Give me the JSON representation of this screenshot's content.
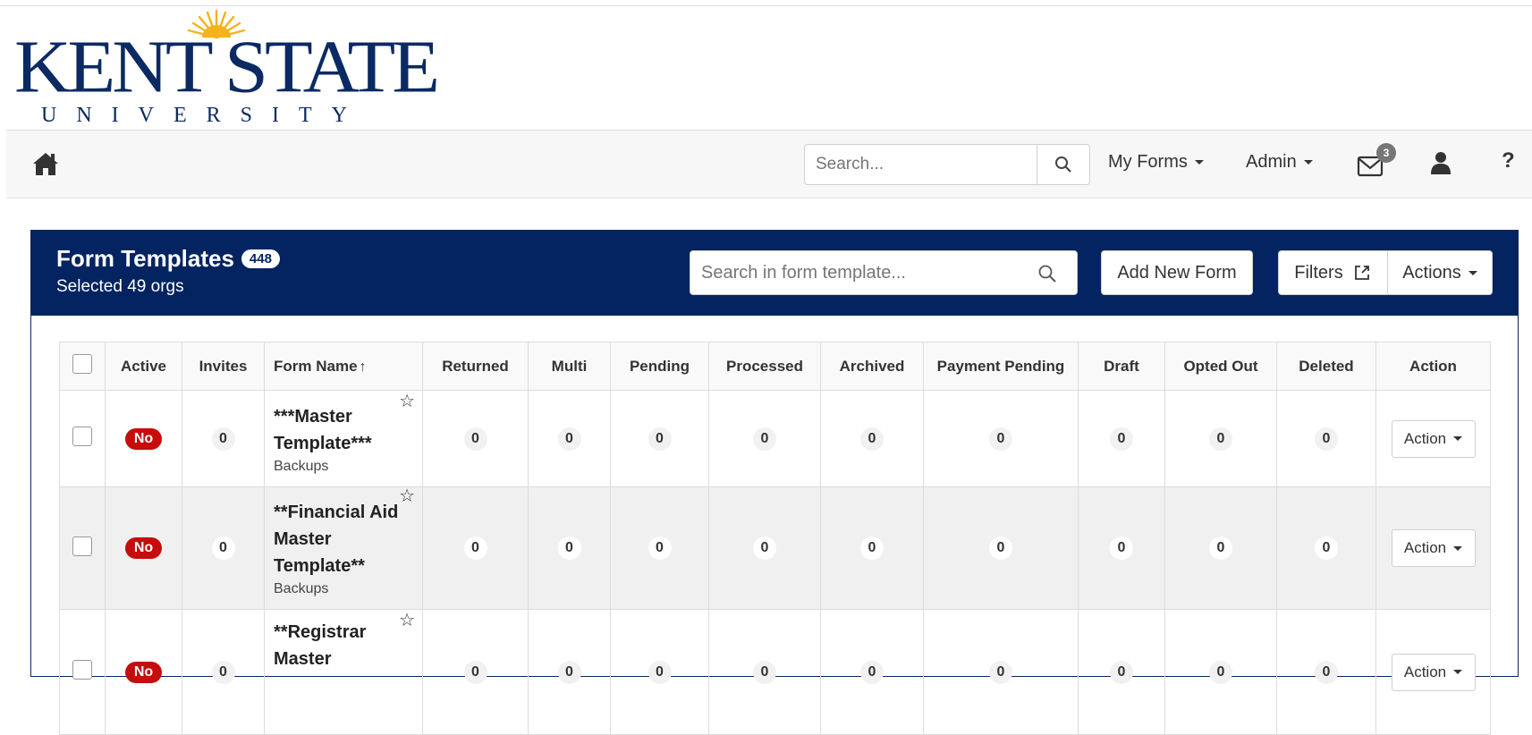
{
  "brand": {
    "name": "KENT STATE",
    "sub": "UNIVERSITY",
    "color": "#0b2a63",
    "accent": "#f5b21b"
  },
  "navbar": {
    "search_placeholder": "Search...",
    "my_forms": "My Forms",
    "admin": "Admin",
    "mail_count": "3",
    "help": "?",
    "icons": [
      "home-icon",
      "search-icon",
      "mail-icon",
      "user-icon"
    ]
  },
  "panel": {
    "title": "Form Templates",
    "count": "448",
    "subtitle": "Selected 49 orgs",
    "search_placeholder": "Search in form template...",
    "add_new": "Add New Form",
    "filters": "Filters",
    "actions": "Actions",
    "header_color": "#032461"
  },
  "table": {
    "columns": [
      "Active",
      "Invites",
      "Form Name",
      "Returned",
      "Multi",
      "Pending",
      "Processed",
      "Archived",
      "Payment Pending",
      "Draft",
      "Opted Out",
      "Deleted",
      "Action"
    ],
    "sort_indicator": "↑",
    "rows": [
      {
        "active": "No",
        "invites": "0",
        "name": "***Master Template***",
        "category": "Backups",
        "returned": "0",
        "multi": "0",
        "pending": "0",
        "processed": "0",
        "archived": "0",
        "payment_pending": "0",
        "draft": "0",
        "opted_out": "0",
        "deleted": "0",
        "action": "Action"
      },
      {
        "active": "No",
        "invites": "0",
        "name": "**Financial Aid Master Template**",
        "category": "Backups",
        "returned": "0",
        "multi": "0",
        "pending": "0",
        "processed": "0",
        "archived": "0",
        "payment_pending": "0",
        "draft": "0",
        "opted_out": "0",
        "deleted": "0",
        "action": "Action"
      },
      {
        "active": "No",
        "invites": "0",
        "name": "**Registrar Master",
        "category": "",
        "returned": "0",
        "multi": "0",
        "pending": "0",
        "processed": "0",
        "archived": "0",
        "payment_pending": "0",
        "draft": "0",
        "opted_out": "0",
        "deleted": "0",
        "action": "Action"
      }
    ],
    "no_badge_color": "#c60c0c"
  }
}
